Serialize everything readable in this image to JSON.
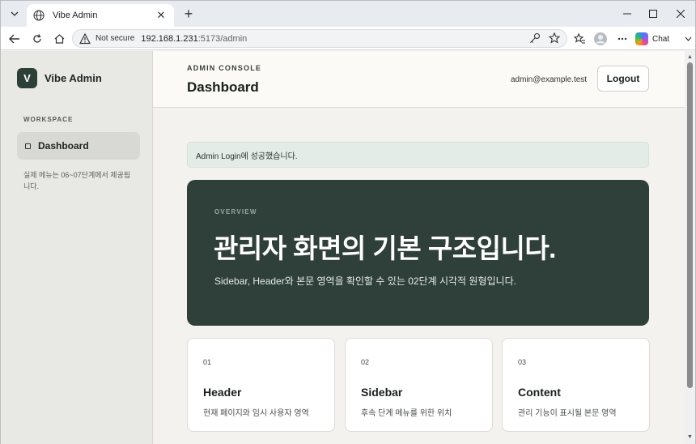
{
  "browser": {
    "tab_title": "Vibe Admin",
    "new_tab_symbol": "+",
    "security_label": "Not secure",
    "url_host": "192.168.1.231",
    "url_rest": ":5173/admin",
    "chat_label": "Chat"
  },
  "sidebar": {
    "brand_initial": "V",
    "brand_name": "Vibe Admin",
    "section_label": "WORKSPACE",
    "items": [
      {
        "label": "Dashboard",
        "active": true
      }
    ],
    "note": "실제 메뉴는 06~07단계에서 제공됩니다."
  },
  "header": {
    "eyebrow": "ADMIN CONSOLE",
    "title": "Dashboard",
    "user_email": "admin@example.test",
    "logout_label": "Logout"
  },
  "alert": {
    "message": "Admin Login에 성공했습니다."
  },
  "hero": {
    "eyebrow": "OVERVIEW",
    "title": "관리자 화면의 기본 구조입니다.",
    "subtitle": "Sidebar, Header와 본문 영역을 확인할 수 있는 02단계 시각적 원형입니다."
  },
  "cards": [
    {
      "number": "01",
      "title": "Header",
      "description": "현재 페이지와 임시 사용자 영역"
    },
    {
      "number": "02",
      "title": "Sidebar",
      "description": "후속 단계 메뉴를 위한 위치"
    },
    {
      "number": "03",
      "title": "Content",
      "description": "관리 기능이 표시될 본문 영역"
    }
  ],
  "colors": {
    "brand": "#2d4038",
    "hero_bg": "#2f3f3a",
    "alert_bg": "#e3ece7",
    "sidebar_bg": "#e8e8e5",
    "page_bg": "#f4f2ee"
  }
}
